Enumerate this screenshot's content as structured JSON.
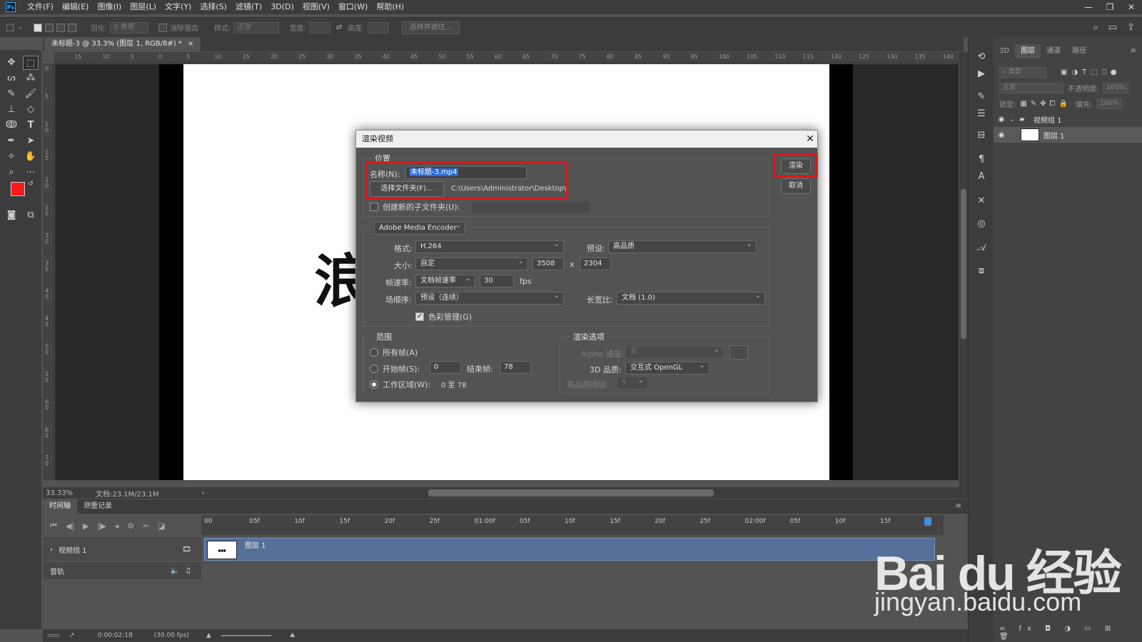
{
  "menubar": {
    "logo": "Ps",
    "items": [
      "文件(F)",
      "编辑(E)",
      "图像(I)",
      "图层(L)",
      "文字(Y)",
      "选择(S)",
      "滤镜(T)",
      "3D(D)",
      "视图(V)",
      "窗口(W)",
      "帮助(H)"
    ],
    "window_controls": [
      "—",
      "❐",
      "✕"
    ]
  },
  "options_bar": {
    "feather_label": "羽化:",
    "feather_value": "0 像素",
    "antialias_label": "消除锯齿",
    "style_label": "样式:",
    "style_value": "正常",
    "width_label": "宽度:",
    "height_label": "高度:",
    "select_mask_button": "选择并遮住..."
  },
  "document": {
    "tab_title": "未标题-3 @ 33.3% (图层 1, RGB/8#) *",
    "tab_close": "×",
    "canvas_glyph": "浪",
    "ruler_h": [
      "15",
      "10",
      "5",
      "0",
      "5",
      "10",
      "15",
      "20",
      "25",
      "30",
      "35",
      "40",
      "45",
      "50",
      "55",
      "60",
      "65",
      "70",
      "75",
      "80",
      "85",
      "90",
      "95",
      "100",
      "105",
      "110",
      "115",
      "120",
      "125",
      "130",
      "135",
      "140"
    ],
    "ruler_v": [
      "0",
      "5",
      "1 0",
      "1 5",
      "2 0",
      "2 5",
      "3 0",
      "3 5",
      "4 0",
      "4 5",
      "5 0",
      "5 5",
      "6 0",
      "6 5",
      "7 0"
    ]
  },
  "statusbar": {
    "zoom": "33.33%",
    "doc_size": "文档:23.1M/23.1M",
    "arrow": "›"
  },
  "timeline": {
    "tabs": [
      "时间轴",
      "测量记录"
    ],
    "timecodes": [
      "00",
      "05f",
      "10f",
      "15f",
      "20f",
      "25f",
      "01:00f",
      "05f",
      "10f",
      "15f",
      "20f",
      "25f",
      "02:00f",
      "05f",
      "10f",
      "15f"
    ],
    "track_name": "视频组 1",
    "clip_label": "图层 1",
    "audio_label": "音轨",
    "current_time": "0:00:02:18",
    "fps": "(30.00 fps)"
  },
  "layers_panel": {
    "tabs": [
      "3D",
      "图层",
      "通道",
      "路径"
    ],
    "active_tab": "图层",
    "filter_label": "类型",
    "blend_mode": "正常",
    "opacity_label": "不透明度:",
    "opacity_value": "100%",
    "lock_label": "锁定:",
    "fill_label": "填充:",
    "fill_value": "100%",
    "layers": [
      {
        "name": "视频组 1"
      },
      {
        "name": "图层 1"
      }
    ]
  },
  "render_dialog": {
    "title": "渲染视频",
    "close": "✕",
    "location_group": "位置",
    "name_label": "名称(N):",
    "name_value": "未标题-3.mp4",
    "choose_folder_button": "选择文件夹(F)...",
    "folder_path": "C:\\Users\\Administrator\\Desktop\\",
    "subfolder_label": "创建新的子文件夹(U):",
    "render_button": "渲染",
    "cancel_button": "取消",
    "encoder": "Adobe Media Encoder",
    "format_label": "格式:",
    "format_value": "H.264",
    "preset_label": "预设:",
    "preset_value": "高品质",
    "size_label": "大小:",
    "size_value": "自定",
    "width_value": "3508",
    "size_x": "x",
    "height_value": "2304",
    "framerate_label": "帧速率:",
    "framerate_value": "文档帧速率",
    "fps_value": "30",
    "fps_unit": "fps",
    "field_order_label": "场顺序:",
    "field_order_value": "预设（连续）",
    "aspect_label": "长宽比:",
    "aspect_value": "文档 (1.0)",
    "color_mgmt_label": "色彩管理(G)",
    "color_mgmt_checked": true,
    "range_group": "范围",
    "all_frames_label": "所有帧(A)",
    "start_frame_label": "开始帧(S):",
    "start_frame_value": "0",
    "end_frame_label": "结束帧:",
    "end_frame_value": "78",
    "work_area_label": "工作区域(W):",
    "work_area_value": "0 至 78",
    "render_options_group": "渲染选项",
    "alpha_label": "Alpha 通道:",
    "alpha_value": "无",
    "quality_3d_label": "3D 品质:",
    "quality_3d_value": "交互式 OpenGL",
    "hq_threshold_label": "高品质阈值:",
    "hq_threshold_value": "5"
  },
  "watermark": {
    "logo_text": "Bai du 经验",
    "url": "jingyan.baidu.com"
  },
  "colors": {
    "foreground": "#ff1a1a",
    "background": "#000000",
    "highlight_box": "#e0161c",
    "selection": "#2b6ad6"
  }
}
